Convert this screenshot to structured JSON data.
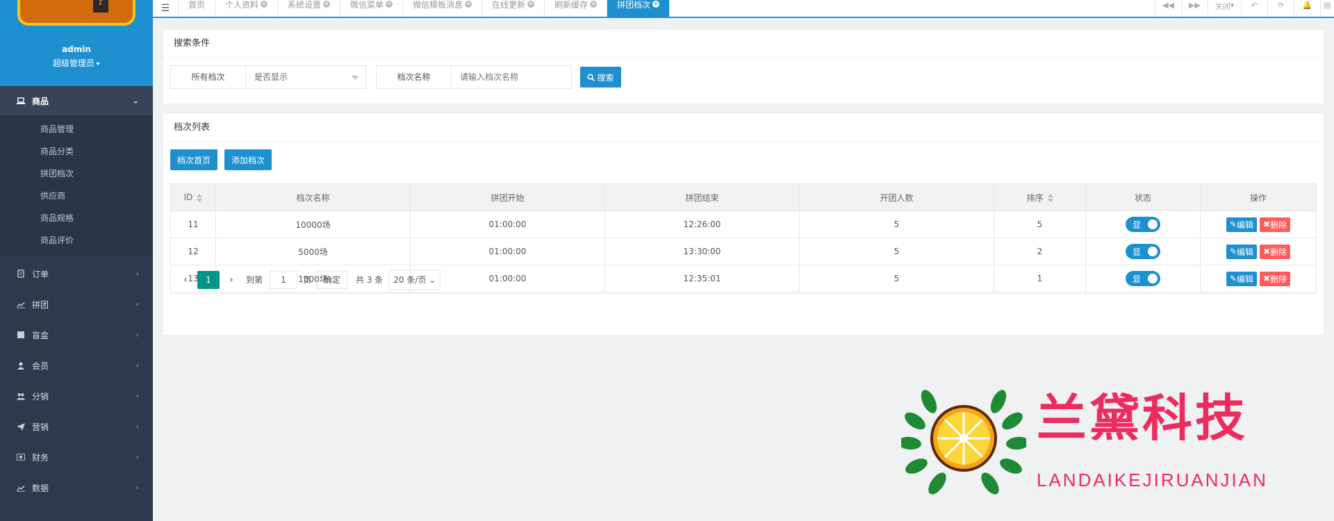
{
  "profile": {
    "username": "admin",
    "role": "超级管理员"
  },
  "sidebar": {
    "groups": [
      {
        "label": "商品",
        "icon": "laptop-icon",
        "expanded": true,
        "items": [
          "商品管理",
          "商品分类",
          "拼团档次",
          "供应商",
          "商品规格",
          "商品评价"
        ]
      },
      {
        "label": "订单",
        "icon": "document-icon"
      },
      {
        "label": "拼团",
        "icon": "chart-line-icon"
      },
      {
        "label": "盲盒",
        "icon": "square-icon"
      },
      {
        "label": "会员",
        "icon": "user-icon"
      },
      {
        "label": "分销",
        "icon": "users-icon"
      },
      {
        "label": "营销",
        "icon": "paper-plane-icon"
      },
      {
        "label": "财务",
        "icon": "money-icon"
      },
      {
        "label": "数据",
        "icon": "chart-area-icon"
      }
    ]
  },
  "topbar": {
    "menu_icon": "☰",
    "tabs": [
      {
        "label": "首页",
        "closable": false
      },
      {
        "label": "个人资料",
        "closable": true
      },
      {
        "label": "系统设置",
        "closable": true
      },
      {
        "label": "微信菜单",
        "closable": true
      },
      {
        "label": "微信模板消息",
        "closable": true
      },
      {
        "label": "在线更新",
        "closable": true
      },
      {
        "label": "刷新缓存",
        "closable": true
      },
      {
        "label": "拼团档次",
        "closable": true,
        "active": true
      }
    ],
    "close_label": "关闭"
  },
  "search": {
    "title": "搜索条件",
    "select_label": "所有档次",
    "select_value": "是否显示",
    "name_label": "档次名称",
    "name_placeholder": "请输入档次名称",
    "search_button": "搜索"
  },
  "list": {
    "title": "档次列表",
    "btn_home": "档次首页",
    "btn_add": "添加档次",
    "columns": [
      "ID",
      "档次名称",
      "拼团开始",
      "拼团结束",
      "开团人数",
      "排序",
      "状态",
      "操作"
    ],
    "rows": [
      {
        "id": "11",
        "name": "10000场",
        "start": "01:00:00",
        "end": "12:26:00",
        "people": "5",
        "sort": "5",
        "status": "显"
      },
      {
        "id": "12",
        "name": "5000场",
        "start": "01:00:00",
        "end": "13:30:00",
        "people": "5",
        "sort": "2",
        "status": "显"
      },
      {
        "id": "13",
        "name": "1000场",
        "start": "01:00:00",
        "end": "12:35:01",
        "people": "5",
        "sort": "1",
        "status": "显"
      }
    ],
    "edit_label": "编辑",
    "delete_label": "删除"
  },
  "pager": {
    "current": "1",
    "goto_label": "到第",
    "goto_value": "1",
    "page_unit": "页",
    "ok_label": "确定",
    "total": "共 3 条",
    "page_size": "20 条/页"
  },
  "watermark": {
    "title": "兰黛科技",
    "subtitle": "LANDAIKEJIRUANJIAN"
  },
  "colors": {
    "accent": "#1e8fcf",
    "sidebar": "#2e3a4b",
    "danger": "#ff5b5b",
    "pager_active": "#009688",
    "brand": "#ec2b5e"
  }
}
